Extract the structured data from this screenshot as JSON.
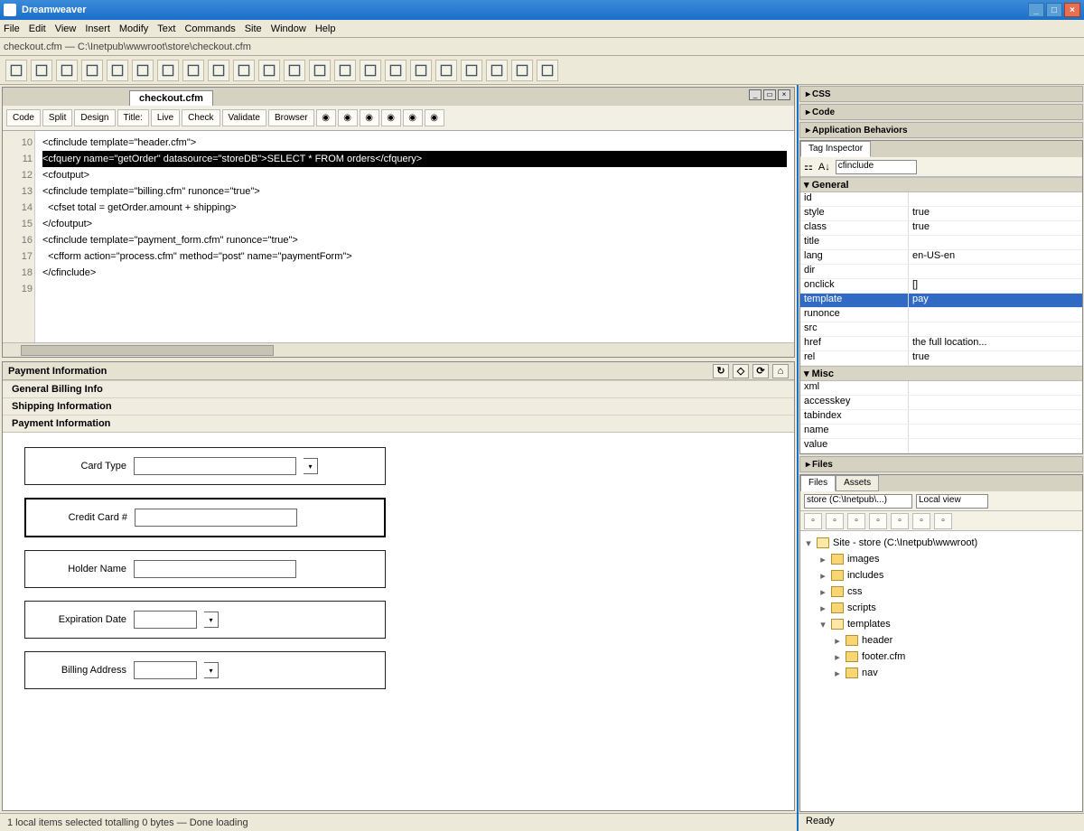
{
  "window": {
    "title": "Dreamweaver",
    "buttons": {
      "min": "_",
      "max": "□",
      "close": "×"
    }
  },
  "menu": [
    "File",
    "Edit",
    "View",
    "Insert",
    "Modify",
    "Text",
    "Commands",
    "Site",
    "Window",
    "Help"
  ],
  "url_row": "checkout.cfm — C:\\Inetpub\\wwwroot\\store\\checkout.cfm",
  "toolbar_groups": [
    "A",
    "B",
    "C",
    "D",
    "E",
    "F",
    "G",
    "H",
    "I",
    "J",
    "K",
    "L",
    "M",
    "N",
    "O",
    "P",
    "Q",
    "R",
    "S",
    "T",
    "U",
    "V"
  ],
  "editor": {
    "active_tab": "checkout.cfm",
    "view_tabs": [
      "Code",
      "Split",
      "Design",
      "Title:",
      "Live",
      "Check",
      "Validate",
      "Browser"
    ],
    "line_numbers": [
      "10",
      "11",
      "12",
      "13",
      "14",
      "15",
      "16",
      "17",
      "18",
      "19"
    ],
    "code_lines": [
      "<cfinclude template=\"header.cfm\">",
      "<cfquery name=\"getOrder\" datasource=\"storeDB\">SELECT * FROM orders</cfquery>",
      "<cfoutput>",
      "<cfinclude template=\"billing.cfm\" runonce=\"true\">",
      "  <cfset total = getOrder.amount + shipping>",
      "</cfoutput>",
      "<cfinclude template=\"payment_form.cfm\" runonce=\"true\">",
      "  <cfform action=\"process.cfm\" method=\"post\" name=\"paymentForm\">",
      "</cfinclude>"
    ],
    "highlighted_index": 1
  },
  "design": {
    "header": "Payment Information",
    "tools": [
      "↻",
      "◇",
      "⟳",
      "⌂"
    ],
    "sections": [
      "General Billing Info",
      "Shipping Information",
      "Payment Information"
    ],
    "form": [
      {
        "label": "Card Type",
        "kind": "select",
        "value": ""
      },
      {
        "label": "Credit Card #",
        "kind": "text",
        "value": "",
        "selected": true
      },
      {
        "label": "Holder Name",
        "kind": "text",
        "value": ""
      },
      {
        "label": "Expiration Date",
        "kind": "select-small",
        "value": ""
      },
      {
        "label": "Billing Address",
        "kind": "select-small",
        "value": ""
      }
    ]
  },
  "right": {
    "collapsed_top": [
      "CSS",
      "Code",
      "Application Behaviors"
    ],
    "props": {
      "tab": "Tag Inspector",
      "combo_label": "cfinclude",
      "sections": [
        {
          "name": "General",
          "rows": [
            {
              "n": "id",
              "v": ""
            },
            {
              "n": "style",
              "v": "true"
            },
            {
              "n": "class",
              "v": "true"
            },
            {
              "n": "title",
              "v": ""
            },
            {
              "n": "lang",
              "v": "en-US-en"
            },
            {
              "n": "dir",
              "v": ""
            },
            {
              "n": "onclick",
              "v": "[]"
            },
            {
              "n": "template",
              "v": "pay",
              "selected": true
            },
            {
              "n": "runonce",
              "v": ""
            },
            {
              "n": "src",
              "v": ""
            },
            {
              "n": "href",
              "v": "the full location..."
            },
            {
              "n": "rel",
              "v": "true"
            }
          ]
        },
        {
          "name": "Misc",
          "rows": [
            {
              "n": "xml",
              "v": ""
            },
            {
              "n": "accesskey",
              "v": ""
            },
            {
              "n": "tabindex",
              "v": ""
            },
            {
              "n": "name",
              "v": ""
            },
            {
              "n": "value",
              "v": ""
            }
          ]
        }
      ]
    },
    "collapsed_mid": [
      "Files"
    ],
    "files": {
      "tabs": [
        "Files",
        "Assets"
      ],
      "combo1": "Local view",
      "combo2": "store (C:\\Inetpub\\...)",
      "tree": [
        {
          "label": "Site - store (C:\\Inetpub\\wwwroot)",
          "depth": 0,
          "open": true
        },
        {
          "label": "images",
          "depth": 1
        },
        {
          "label": "includes",
          "depth": 1
        },
        {
          "label": "css",
          "depth": 1
        },
        {
          "label": "scripts",
          "depth": 1
        },
        {
          "label": "templates",
          "depth": 1,
          "open": true
        },
        {
          "label": "header",
          "depth": 2
        },
        {
          "label": "footer.cfm",
          "depth": 2
        },
        {
          "label": "nav",
          "depth": 2
        }
      ]
    },
    "status": "Ready"
  },
  "main_status": "1 local items selected totalling 0 bytes — Done loading"
}
